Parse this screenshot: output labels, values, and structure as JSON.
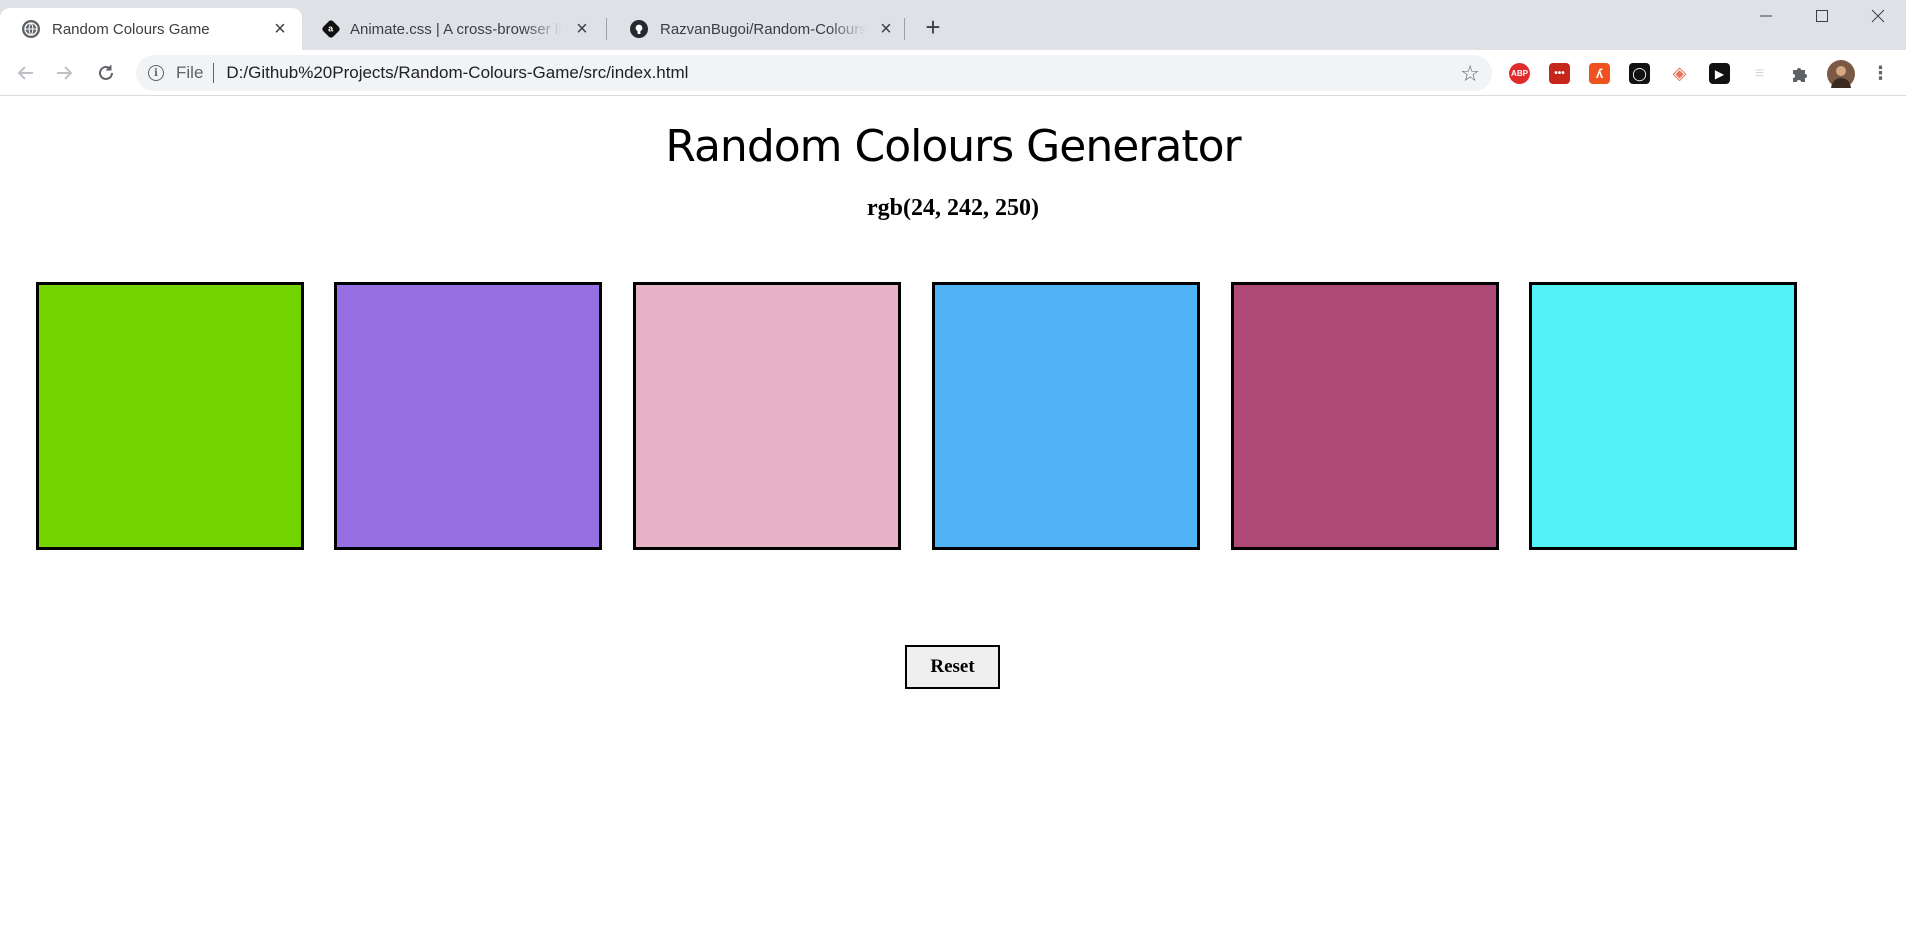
{
  "browser": {
    "tabs": [
      {
        "title": "Random Colours Game",
        "favicon": "globe-icon",
        "active": true
      },
      {
        "title": "Animate.css | A cross-browser library",
        "favicon": "animate-logo-icon",
        "active": false
      },
      {
        "title": "RazvanBugoi/Random-Colours-Game",
        "favicon": "github-icon",
        "active": false
      }
    ],
    "new_tab_icon": "plus-icon",
    "address": {
      "scheme_label": "File",
      "url": "D:/Github%20Projects/Random-Colours-Game/src/index.html"
    },
    "extensions": [
      {
        "name": "adblock-plus-icon",
        "label": "ABP",
        "color": "#e22b2b"
      },
      {
        "name": "lastpass-icon",
        "label": "•••",
        "color": "#c7261b"
      },
      {
        "name": "extension-orange-icon",
        "label": "ʎ",
        "color": "#f0521f"
      },
      {
        "name": "extension-black-icon",
        "label": "◯",
        "color": "#111111"
      },
      {
        "name": "shield-extension-icon",
        "label": "◈",
        "color": "#e8735a"
      },
      {
        "name": "play-extension-icon",
        "label": "▶",
        "color": "#111111"
      },
      {
        "name": "extension-faded-icon",
        "label": "≡",
        "color": "#d8d8d8"
      },
      {
        "name": "puzzle-extensions-icon",
        "label": "",
        "color": "#5f6368"
      }
    ]
  },
  "page": {
    "heading": "Random Colours Generator",
    "target_rgb": "rgb(24, 242, 250)",
    "swatches": [
      {
        "color": "#74d400"
      },
      {
        "color": "#9670e3"
      },
      {
        "color": "#e6b3c9"
      },
      {
        "color": "#50b3f6"
      },
      {
        "color": "#af4977"
      },
      {
        "color": "#52f2f7"
      }
    ],
    "reset_label": "Reset"
  }
}
